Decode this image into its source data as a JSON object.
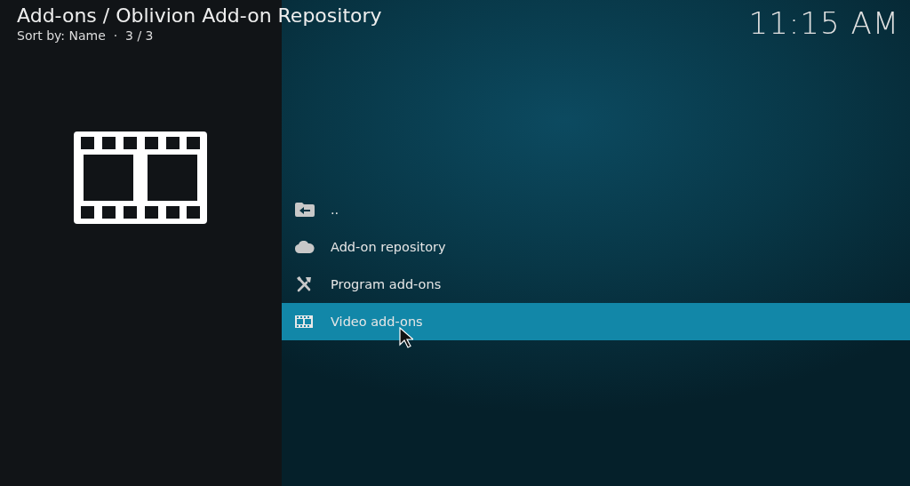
{
  "header": {
    "title": "Add-ons / Oblivion Add-on Repository",
    "subtitle": "Sort by: Name  ·  3 / 3",
    "clock": "11:15 AM"
  },
  "items": [
    {
      "kind": "parent",
      "label": "..",
      "selected": false
    },
    {
      "kind": "repository",
      "label": "Add-on repository",
      "selected": false
    },
    {
      "kind": "program",
      "label": "Program add-ons",
      "selected": false
    },
    {
      "kind": "video",
      "label": "Video add-ons",
      "selected": true
    }
  ]
}
